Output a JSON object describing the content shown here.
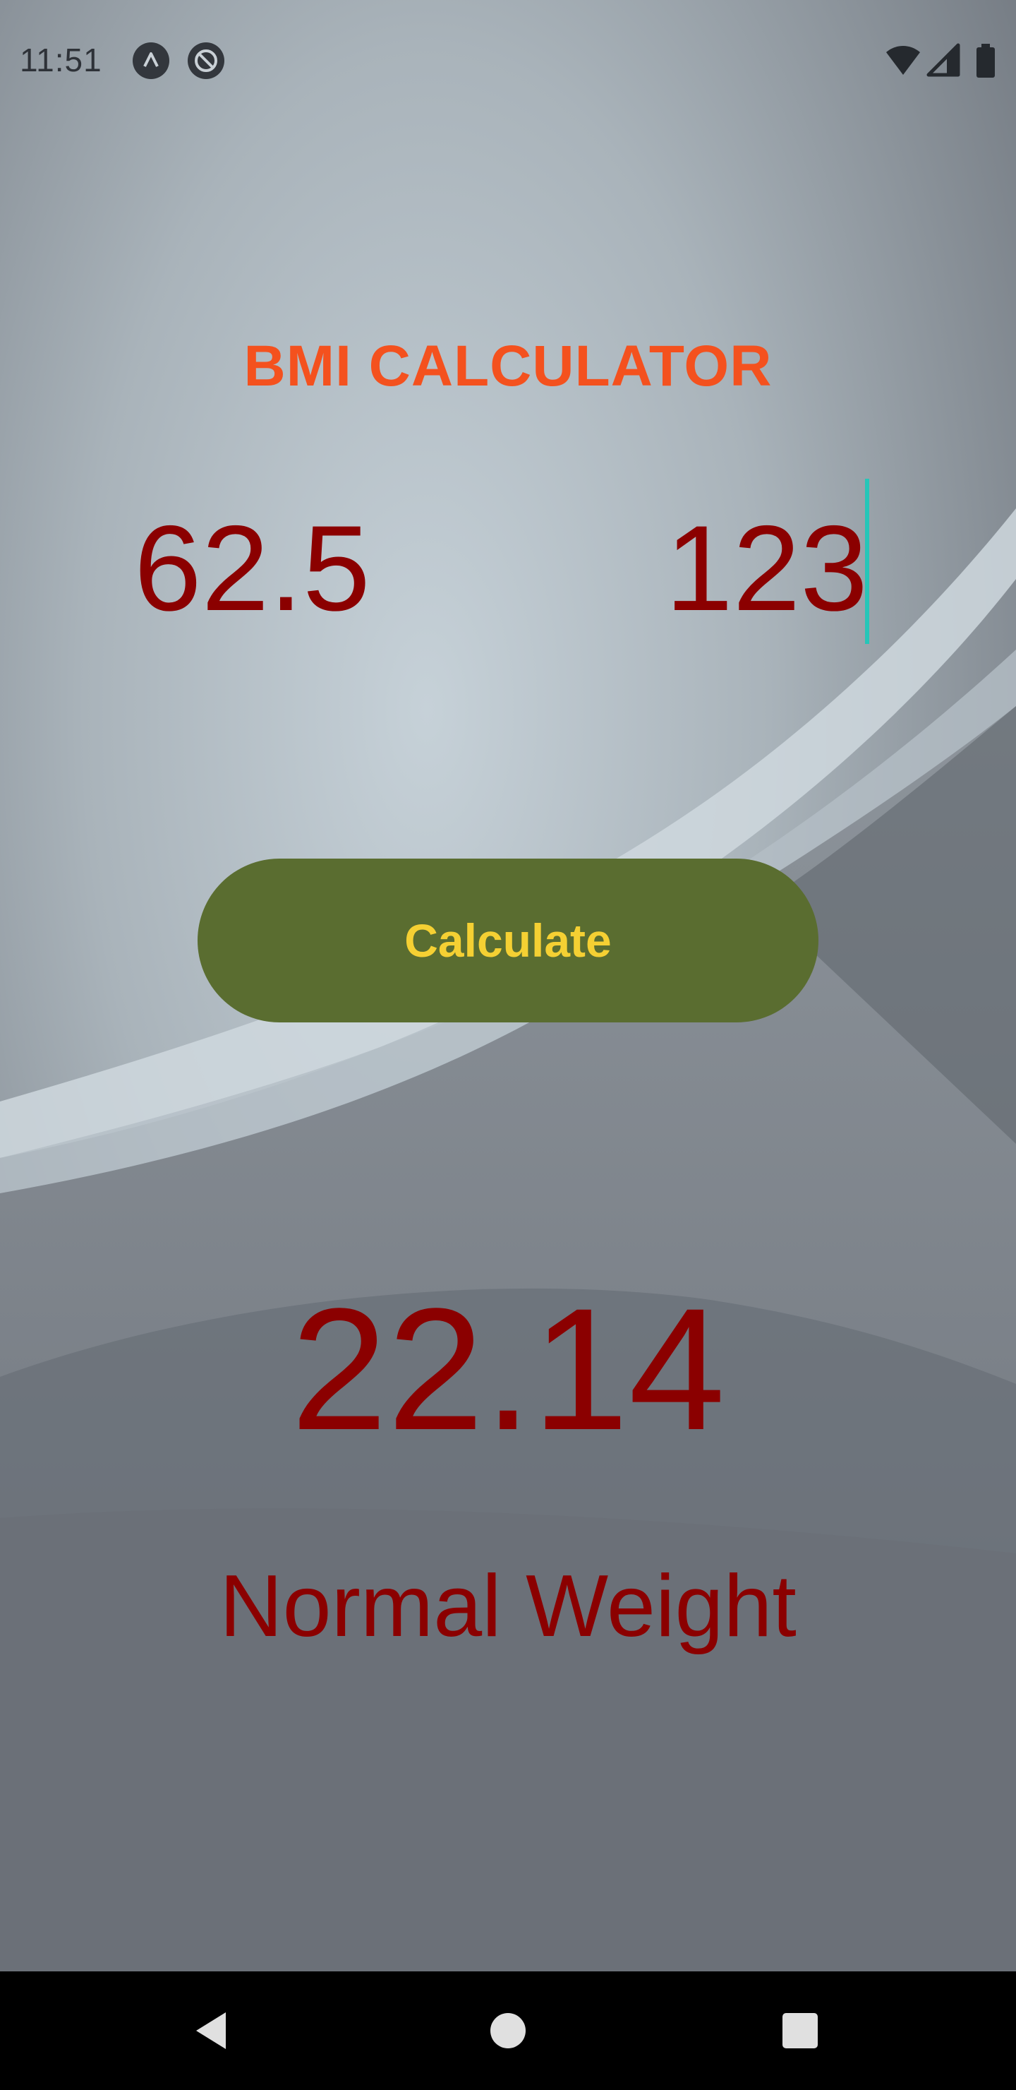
{
  "status_bar": {
    "time": "11:51",
    "left_icons": [
      "a-letter-icon",
      "no-sync-icon"
    ],
    "right_icons": [
      "wifi-icon",
      "cell-signal-icon",
      "battery-icon"
    ]
  },
  "app": {
    "title": "BMI CALCULATOR",
    "title_color": "#f4511e",
    "weight_value": "62.5",
    "height_value": "123",
    "calculate_label": "Calculate",
    "button_color": "#5a6d30",
    "button_text_color": "#f5d033",
    "bmi_value": "22.14",
    "bmi_category": "Normal Weight",
    "value_color": "#8b0000"
  },
  "nav_bar": {
    "buttons": [
      "back-icon",
      "home-icon",
      "recents-icon"
    ]
  }
}
